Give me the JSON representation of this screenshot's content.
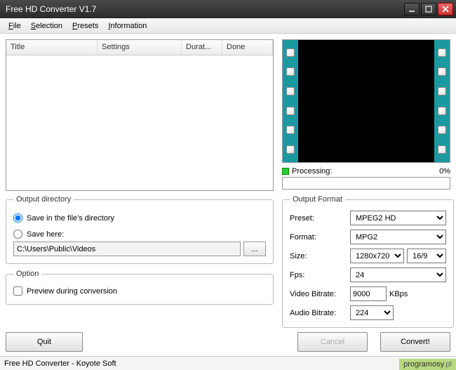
{
  "window": {
    "title": "Free HD Converter V1.7"
  },
  "menu": {
    "file": "File",
    "selection": "Selection",
    "presets": "Presets",
    "information": "Information"
  },
  "filelist": {
    "cols": {
      "title": "Title",
      "settings": "Settings",
      "duration": "Durat...",
      "done": "Done"
    }
  },
  "processing": {
    "label": "Processing:",
    "percent": "0%"
  },
  "outdir": {
    "legend": "Output directory",
    "radio_same": "Save in the file's directory",
    "radio_here": "Save here:",
    "path": "C:\\Users\\Public\\Videos",
    "browse": "..."
  },
  "option": {
    "legend": "Option",
    "preview": "Preview during conversion"
  },
  "format": {
    "legend": "Output Format",
    "preset_label": "Preset:",
    "preset_value": "MPEG2 HD",
    "format_label": "Format:",
    "format_value": "MPG2",
    "size_label": "Size:",
    "size_value": "1280x720",
    "ratio_value": "16/9",
    "fps_label": "Fps:",
    "fps_value": "24",
    "vbr_label": "Video Bitrate:",
    "vbr_value": "9000",
    "vbr_unit": "KBps",
    "abr_label": "Audio Bitrate:",
    "abr_value": "224"
  },
  "buttons": {
    "quit": "Quit",
    "cancel": "Cancel",
    "convert": "Convert!"
  },
  "statusbar": "Free HD Converter - Koyote Soft",
  "watermark": {
    "a": "programosy",
    "b": ".pl"
  }
}
